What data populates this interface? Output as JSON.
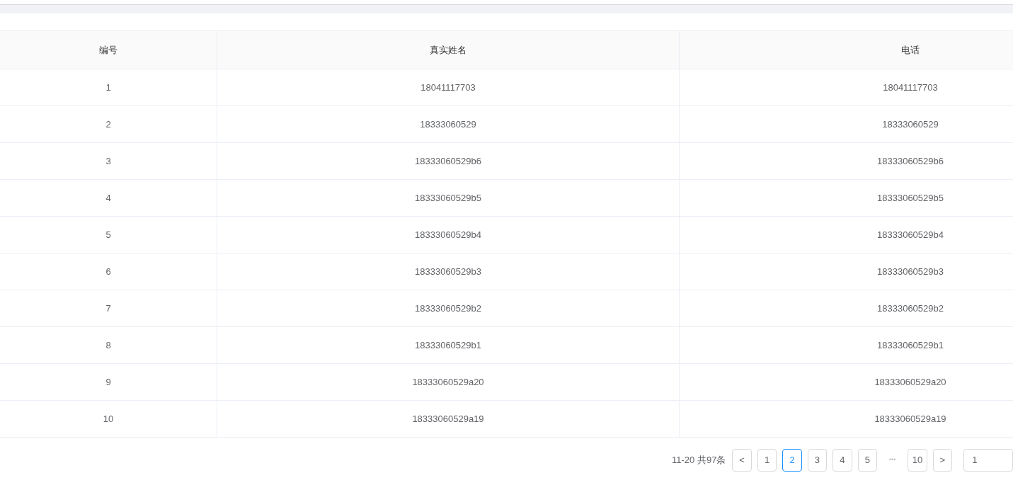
{
  "table": {
    "columns": [
      "编号",
      "真实姓名",
      "电话"
    ],
    "rows": [
      {
        "cells": [
          "1",
          "18041117703",
          "18041117703"
        ]
      },
      {
        "cells": [
          "2",
          "18333060529",
          "18333060529"
        ]
      },
      {
        "cells": [
          "3",
          "18333060529b6",
          "18333060529b6"
        ]
      },
      {
        "cells": [
          "4",
          "18333060529b5",
          "18333060529b5"
        ]
      },
      {
        "cells": [
          "5",
          "18333060529b4",
          "18333060529b4"
        ]
      },
      {
        "cells": [
          "6",
          "18333060529b3",
          "18333060529b3"
        ]
      },
      {
        "cells": [
          "7",
          "18333060529b2",
          "18333060529b2"
        ]
      },
      {
        "cells": [
          "8",
          "18333060529b1",
          "18333060529b1"
        ]
      },
      {
        "cells": [
          "9",
          "18333060529a20",
          "18333060529a20"
        ]
      },
      {
        "cells": [
          "10",
          "18333060529a19",
          "18333060529a19"
        ]
      }
    ]
  },
  "pagination": {
    "total": "11-20 共97条",
    "prev": "<",
    "next": ">",
    "pages": [
      {
        "kind": "page",
        "label": "1",
        "selected": false
      },
      {
        "kind": "page",
        "label": "2",
        "selected": true
      },
      {
        "kind": "page",
        "label": "3",
        "selected": false
      },
      {
        "kind": "page",
        "label": "4",
        "selected": false
      },
      {
        "kind": "page",
        "label": "5",
        "selected": false
      },
      {
        "kind": "ellipsis",
        "label": "•••",
        "selected": false
      },
      {
        "kind": "page",
        "label": "10",
        "selected": false
      }
    ],
    "page_size": "1"
  }
}
